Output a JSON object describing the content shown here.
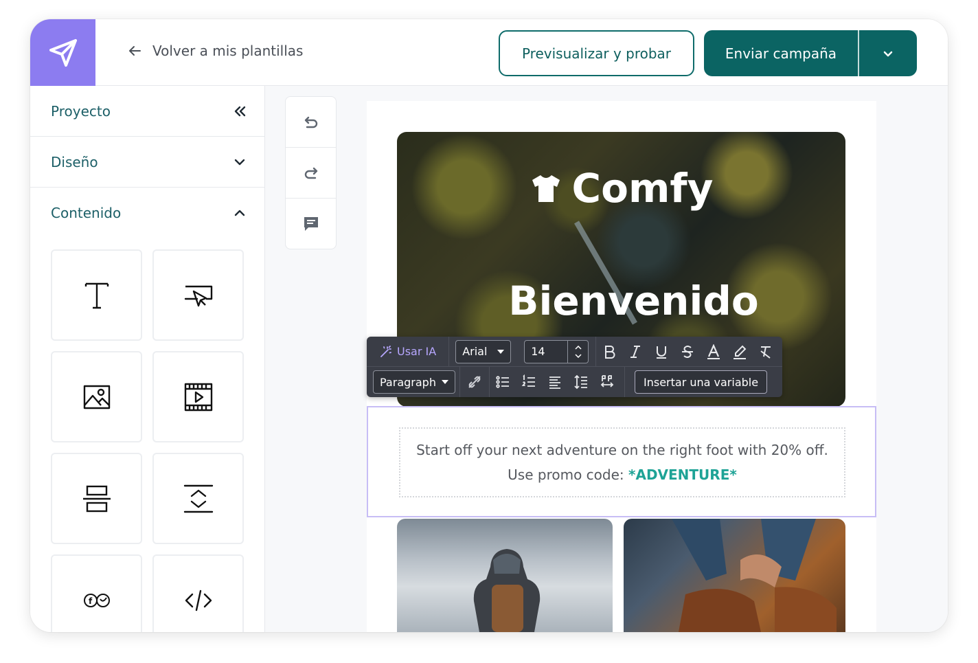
{
  "header": {
    "back_label": "Volver a mis plantillas",
    "preview_label": "Previsualizar y probar",
    "send_label": "Enviar campaña"
  },
  "sidebar": {
    "sections": [
      {
        "label": "Proyecto",
        "icon": "double-chevron-left-icon"
      },
      {
        "label": "Diseño",
        "icon": "chevron-down-icon"
      },
      {
        "label": "Contenido",
        "icon": "chevron-up-icon"
      }
    ],
    "tiles": [
      "text",
      "button",
      "image",
      "video",
      "divider",
      "spacer",
      "social",
      "html"
    ]
  },
  "email": {
    "brand": "Comfy",
    "headline": "Bienvenido",
    "body_line1": "Start off your next adventure on the right foot with 20% off.",
    "body_line2_prefix": "Use promo code:",
    "promo_code": "*ADVENTURE*"
  },
  "toolbar": {
    "ai_label": "Usar IA",
    "font": "Arial",
    "size": "14",
    "block_type": "Paragraph",
    "variable_label": "Insertar una variable"
  },
  "colors": {
    "brand_purple": "#8c7cf0",
    "teal": "#0b6463",
    "promo_teal": "#1ea396"
  }
}
